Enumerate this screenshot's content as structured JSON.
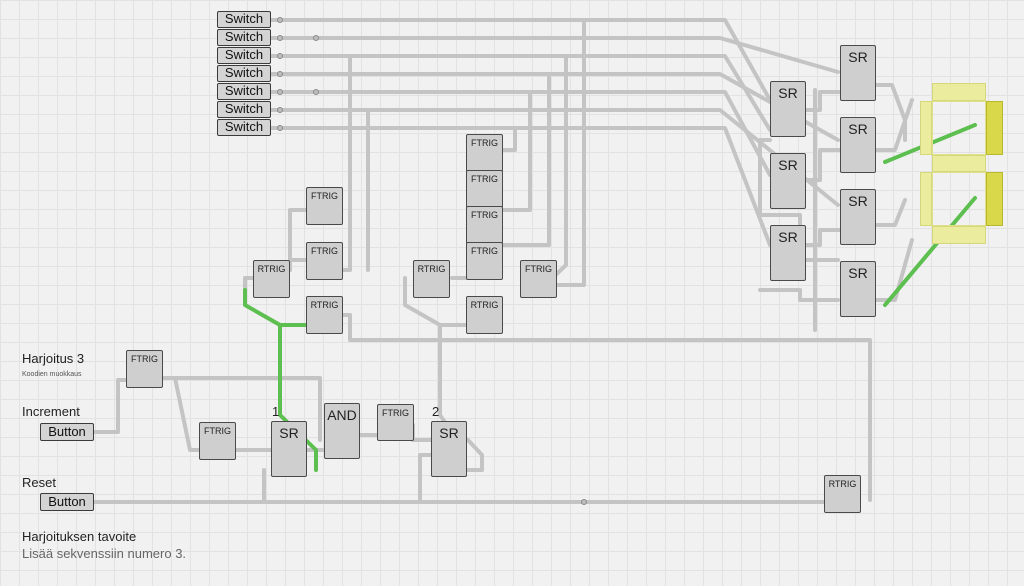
{
  "switches": [
    "Switch",
    "Switch",
    "Switch",
    "Switch",
    "Switch",
    "Switch",
    "Switch"
  ],
  "gates": {
    "ftrig_label": "FTRIG",
    "rtrig_label": "RTRIG",
    "sr_label": "SR",
    "and_label": "AND"
  },
  "labels": {
    "exercise_title": "Harjoitus 3",
    "exercise_subtitle": "Koodien muokkaus",
    "increment": "Increment",
    "reset": "Reset",
    "goal_title": "Harjoituksen tavoite",
    "goal_text": "Lisää sekvenssiin numero 3.",
    "sr1_number": "1",
    "sr2_number": "2"
  },
  "buttons": {
    "increment_button": "Button",
    "reset_button": "Button"
  },
  "colors": {
    "wire_off": "#c8c8c8",
    "wire_on": "#5cbf4f",
    "segment_on": "#d8d84a",
    "segment_off": "#ecec9e"
  },
  "display": {
    "digit_count": 2,
    "active_wires": 3
  }
}
